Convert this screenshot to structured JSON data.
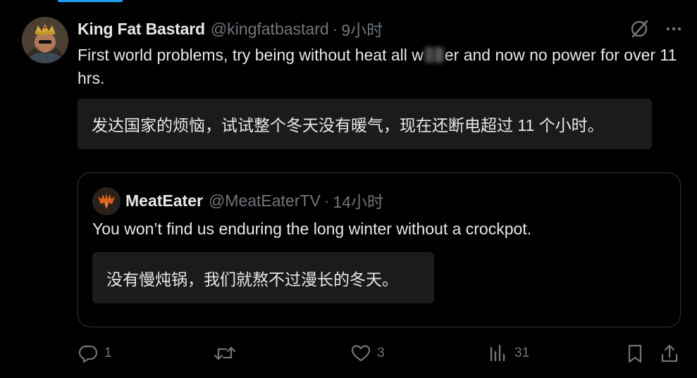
{
  "tweet": {
    "display_name": "King Fat Bastard",
    "handle": "@kingfatbastard",
    "separator": "·",
    "time": "9小时",
    "text_part1": "First world problems, try being without heat all w",
    "text_part2": "er and now no power for over 11 hrs.",
    "translation": "发达国家的烦恼，试试整个冬天没有暖气，现在还断电超过 11 个小时。"
  },
  "quote": {
    "display_name": "MeatEater",
    "handle": "@MeatEaterTV",
    "separator": "·",
    "time": "14小时",
    "text": "You won’t find us enduring the long winter without a crockpot.",
    "translation": "没有慢炖锅，我们就熬不过漫长的冬天。"
  },
  "actions": {
    "replies": "1",
    "retweets": "",
    "likes": "3",
    "views": "31"
  },
  "icons": {
    "header": [
      "grok-icon",
      "more-icon"
    ],
    "actions": [
      "reply-icon",
      "retweet-icon",
      "like-icon",
      "views-icon",
      "bookmark-icon",
      "share-icon"
    ]
  },
  "colors": {
    "background": "#000000",
    "text": "#e7e9ea",
    "muted": "#71767b",
    "translation_bg": "#1c1a1b",
    "border": "#2f3336",
    "accent": "#1d9bf0"
  }
}
